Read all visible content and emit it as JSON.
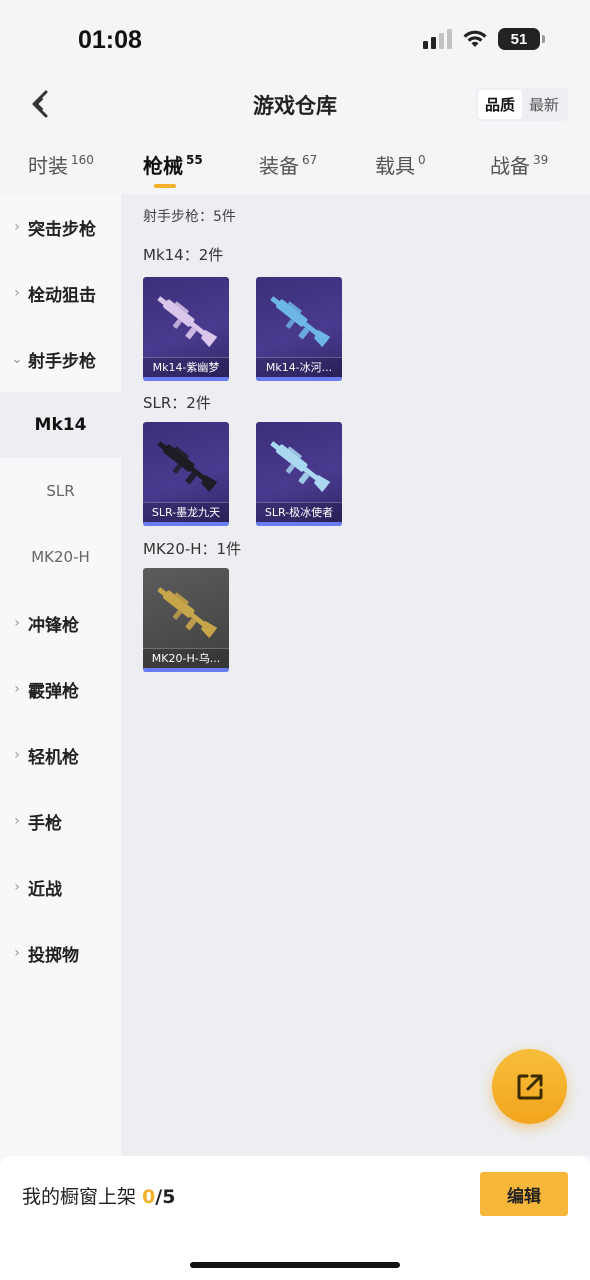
{
  "status_bar": {
    "time": "01:08",
    "battery": "51"
  },
  "header": {
    "title": "游戏仓库",
    "sort_options": [
      "品质",
      "最新"
    ],
    "sort_active": "品质"
  },
  "tabs": [
    {
      "label": "时装",
      "count": "160"
    },
    {
      "label": "枪械",
      "count": "55",
      "active": true
    },
    {
      "label": "装备",
      "count": "67"
    },
    {
      "label": "载具",
      "count": "0"
    },
    {
      "label": "战备",
      "count": "39"
    }
  ],
  "sidebar": {
    "items": [
      {
        "label": "突击步枪",
        "type": "category"
      },
      {
        "label": "栓动狙击",
        "type": "category"
      },
      {
        "label": "射手步枪",
        "type": "category",
        "expanded": true
      },
      {
        "label": "Mk14",
        "type": "sub",
        "active": true
      },
      {
        "label": "SLR",
        "type": "sub"
      },
      {
        "label": "MK20-H",
        "type": "sub"
      },
      {
        "label": "冲锋枪",
        "type": "category"
      },
      {
        "label": "霰弹枪",
        "type": "category"
      },
      {
        "label": "轻机枪",
        "type": "category"
      },
      {
        "label": "手枪",
        "type": "category"
      },
      {
        "label": "近战",
        "type": "category"
      },
      {
        "label": "投掷物",
        "type": "category"
      }
    ]
  },
  "content": {
    "summary": "射手步枪：5件",
    "groups": [
      {
        "title": "Mk14：2件",
        "items": [
          {
            "name": "Mk14-紫幽梦",
            "style": "purple",
            "gun_color": "#d9c6ea"
          },
          {
            "name": "Mk14-冰河...",
            "style": "purple",
            "gun_color": "#6db7e6"
          }
        ]
      },
      {
        "title": "SLR：2件",
        "items": [
          {
            "name": "SLR-墨龙九天",
            "style": "purple",
            "gun_color": "#1e1b24"
          },
          {
            "name": "SLR-极冰使者",
            "style": "purple",
            "gun_color": "#a9d8f0"
          }
        ]
      },
      {
        "title": "MK20-H：1件",
        "items": [
          {
            "name": "MK20-H-乌...",
            "style": "gray",
            "gun_color": "#c7a54a"
          }
        ]
      }
    ]
  },
  "bottom_bar": {
    "label": "我的橱窗上架",
    "count": "0",
    "total": "/5",
    "edit_label": "编辑"
  },
  "colors": {
    "accent": "#f3b02c",
    "card_purple": "#4a3a8f",
    "card_gray": "#555555",
    "rarity_bar": "#6a7cf2"
  },
  "icons": {
    "back": "chevron-left-icon",
    "share": "external-link-icon"
  }
}
